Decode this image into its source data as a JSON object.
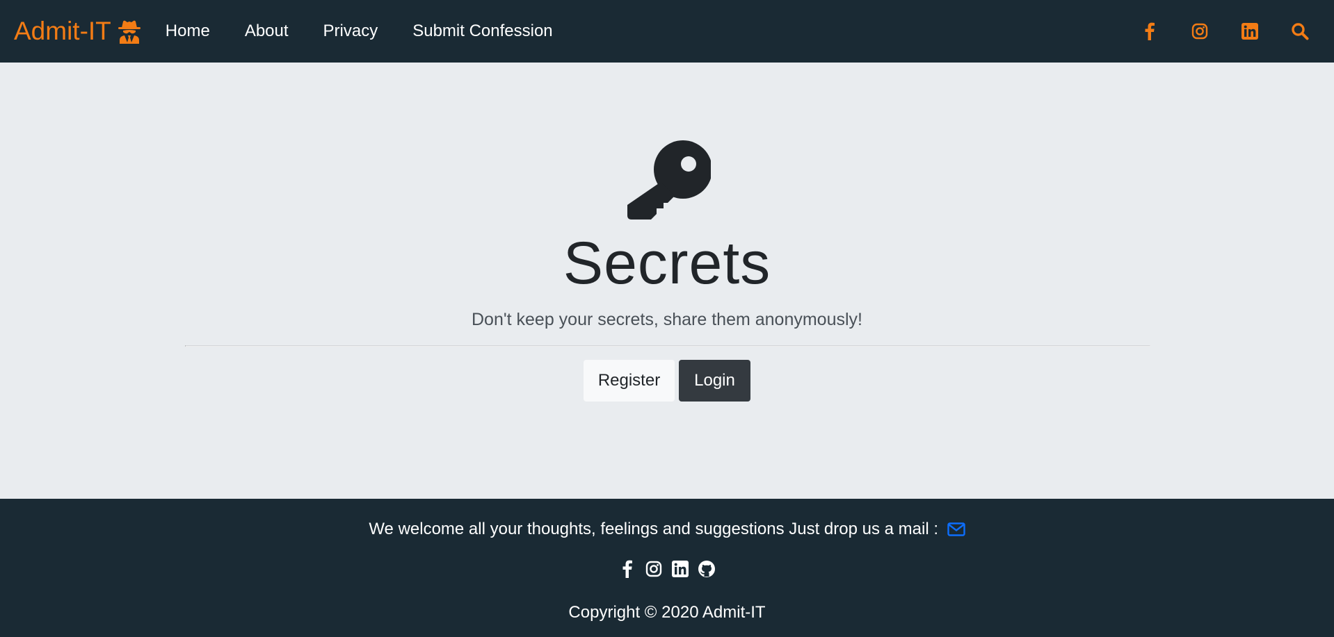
{
  "navbar": {
    "brand": "Admit-IT",
    "brand_icon": "user-secret-icon",
    "links": [
      "Home",
      "About",
      "Privacy",
      "Submit Confession"
    ],
    "icons": [
      "facebook-icon",
      "instagram-icon",
      "linkedin-icon",
      "search-icon"
    ],
    "accent_color": "#f37c15",
    "background_color": "#1a2a34"
  },
  "hero": {
    "icon": "key-icon",
    "title": "Secrets",
    "subtitle": "Don't keep your secrets, share them anonymously!",
    "register_label": "Register",
    "login_label": "Login"
  },
  "footer": {
    "message": "We welcome all your thoughts, feelings and suggestions Just drop us a mail :",
    "mail_icon": "envelope-icon",
    "social_icons": [
      "facebook-icon",
      "instagram-icon",
      "linkedin-icon",
      "github-icon"
    ],
    "copyright": "Copyright © 2020 Admit-IT",
    "mail_icon_color": "#0d6efd"
  }
}
